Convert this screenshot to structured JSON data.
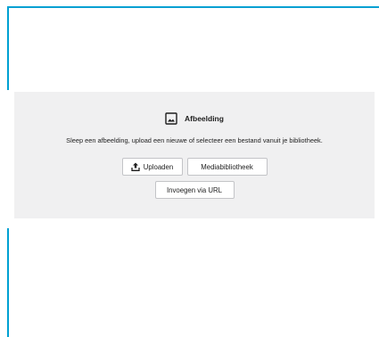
{
  "block": {
    "title": "Afbeelding",
    "icon": "image-icon",
    "instructions": "Sleep een afbeelding, upload een nieuwe of selecteer een bestand vanuit je bibliotheek."
  },
  "buttons": {
    "upload_label": "Uploaden",
    "upload_icon": "upload-icon",
    "media_library_label": "Mediabibliotheek",
    "insert_url_label": "Invoegen via URL"
  },
  "colors": {
    "selection_border": "#00a0d2",
    "placeholder_bg": "#f0f0f1",
    "button_border": "#c3c4c7"
  }
}
